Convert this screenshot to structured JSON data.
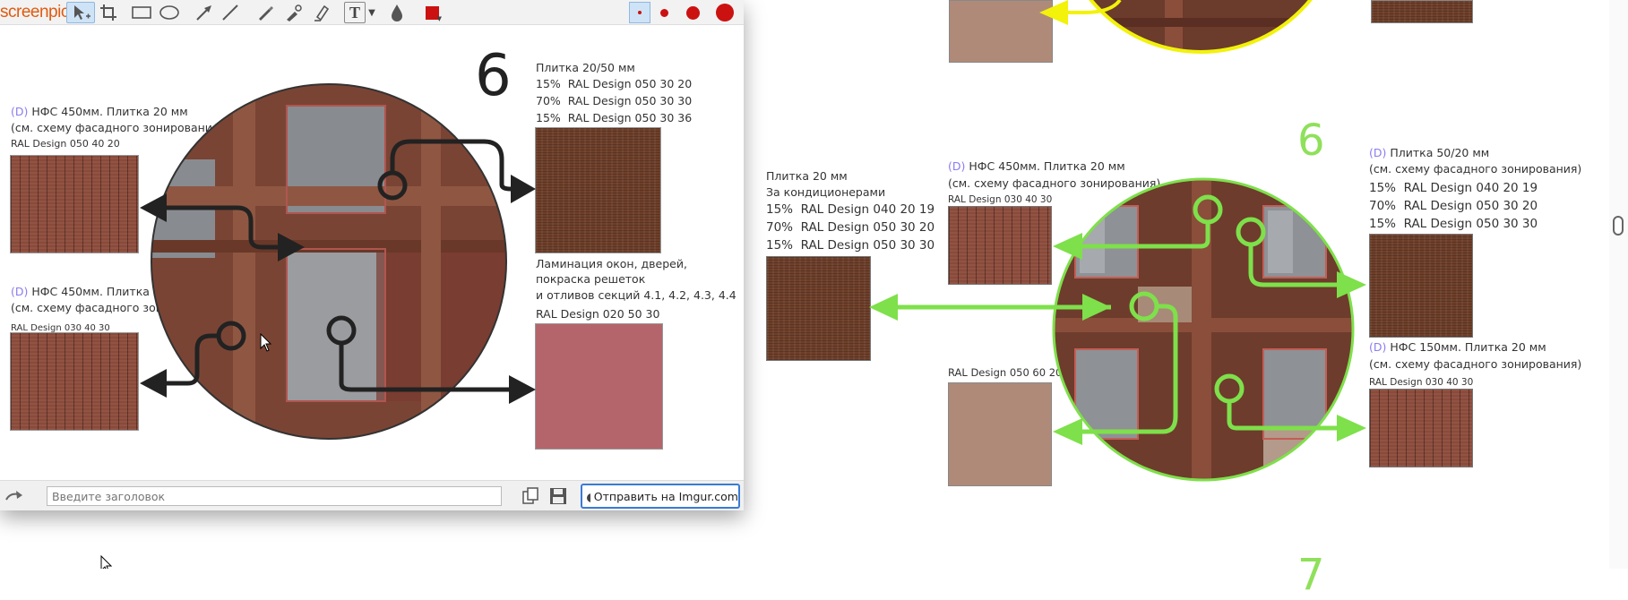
{
  "app": {
    "logo": "screenpic"
  },
  "toolbar": {
    "text_tool": "T",
    "brush_sizes": [
      "xs",
      "s",
      "m",
      "l"
    ],
    "color": "#cc1111"
  },
  "bottom": {
    "title_placeholder": "Введите заголовок",
    "upload_label": "Отправить на Imgur.com"
  },
  "editor_image": {
    "number": "6",
    "left_top": {
      "tag": "(D)",
      "title": "НФС 450мм. Плитка 20 мм",
      "note": "(см. схему фасадного зонирования)",
      "ral": "RAL Design 050 40 20"
    },
    "left_bottom": {
      "tag": "(D)",
      "title": "НФС 450мм. Плитка 20 мм",
      "note": "(см. схему фасадного зонирования)",
      "ral": "RAL Design 030 40 30"
    },
    "right_top": {
      "title": "Плитка 20/50 мм",
      "rows": [
        {
          "p": "15%",
          "ral": "RAL Design 050 30 20"
        },
        {
          "p": "70%",
          "ral": "RAL Design 050 30 30"
        },
        {
          "p": "15%",
          "ral": "RAL Design 050 30 36"
        }
      ]
    },
    "right_bottom": {
      "l1": "Ламинация окон, дверей,",
      "l2": "покраска решеток",
      "l3": "и отливов секций 4.1, 4.2, 4.3, 4.4",
      "ral": "RAL Design 020 50 30"
    }
  },
  "document": {
    "number_top": "6",
    "number_bottom": "7",
    "conditioner": {
      "title": "Плитка 20 мм",
      "subtitle": "За кондиционерами",
      "rows": [
        {
          "p": "15%",
          "ral": "RAL Design 040 20 19"
        },
        {
          "p": "70%",
          "ral": "RAL Design 050 30 20"
        },
        {
          "p": "15%",
          "ral": "RAL Design 050 30 30"
        }
      ]
    },
    "center_top": {
      "tag": "(D)",
      "title": "НФС 450мм. Плитка 20 мм",
      "note": "(см. схему фасадного зонирования)",
      "ral": "RAL Design 030 40 30"
    },
    "center_bottom": {
      "ral": "RAL Design 050 60 20"
    },
    "right_top": {
      "tag": "(D)",
      "title": "Плитка 50/20 мм",
      "note": "(см. схему фасадного зонирования)",
      "rows": [
        {
          "p": "15%",
          "ral": "RAL Design 040 20 19"
        },
        {
          "p": "70%",
          "ral": "RAL Design 050 30 20"
        },
        {
          "p": "15%",
          "ral": "RAL Design 050 30 30"
        }
      ]
    },
    "right_bottom": {
      "tag": "(D)",
      "title": "НФС 150мм. Плитка 20 мм",
      "note": "(см. схему фасадного зонирования)",
      "ral": "RAL Design 030 40 30"
    }
  },
  "colors": {
    "green": "#7ee04a",
    "yellow": "#f2f20a",
    "swatch_pink": "#b4656b",
    "swatch_beige": "#b08a78"
  }
}
